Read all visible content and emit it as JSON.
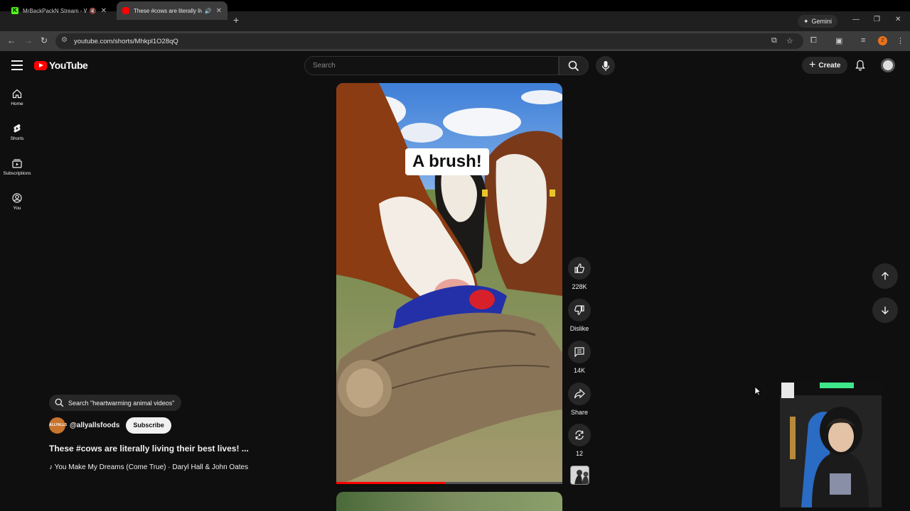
{
  "browser": {
    "tabs": [
      {
        "title": "MrBackPackN Stream - Wa",
        "favicon_color": "#53fc18"
      },
      {
        "title": "These #cows are literally livi",
        "favicon_color": "#ff0000"
      }
    ],
    "gemini_label": "Gemini",
    "url": "youtube.com/shorts/Mhkpl1O28qQ",
    "profile_initial": "Z"
  },
  "youtube": {
    "logo_text": "YouTube",
    "search_placeholder": "Search",
    "create_label": "Create",
    "sidebar": [
      {
        "label": "Home",
        "icon": "home-icon"
      },
      {
        "label": "Shorts",
        "icon": "shorts-icon"
      },
      {
        "label": "Subscriptions",
        "icon": "subscriptions-icon"
      },
      {
        "label": "You",
        "icon": "you-icon"
      }
    ],
    "short": {
      "caption": "A brush!",
      "progress": 0.48,
      "actions": {
        "like": "228K",
        "dislike": "Dislike",
        "comments": "14K",
        "share": "Share",
        "remix": "12"
      }
    },
    "info": {
      "search_chip": "Search \"heartwarming animal videos\"",
      "channel_avatar_text": "ALLYALLS",
      "channel": "@allyallsfoods",
      "subscribe_label": "Subscribe",
      "title": "These #cows are literally living their best lives! ...",
      "music": "You Make My Dreams (Come True) · Daryl Hall & John Oates"
    }
  }
}
